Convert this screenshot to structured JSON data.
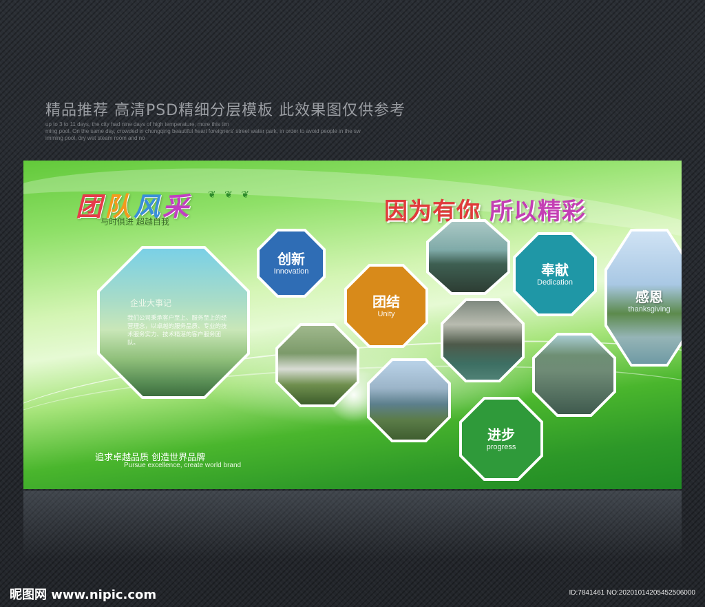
{
  "header": {
    "title": "精品推荐 高清PSD精细分层模板 此效果图仅供参考",
    "sub_lines": [
      "up to 3 to 11 days, the city had nine days of high temperature, more this tim",
      "ming pool. On the same day, crowded in chongqing beautiful heart foreigners' street water park, in order to avoid people in the sw",
      "imming pool, dry wet steam room and no"
    ]
  },
  "board": {
    "team_title_chars": [
      "团",
      "队",
      "风",
      "采"
    ],
    "team_subtitle": "与时俱进 超越自我",
    "slogan_part1": "因为有你",
    "slogan_part2": "所以精彩",
    "event_box": {
      "title": "企业大事记",
      "body": "我们公司秉承客户至上、服务至上的经营理念，以卓越的服务品质、专业的技术服务实力、技术精湛的客户服务团队。"
    },
    "values": [
      {
        "cn": "创新",
        "en": "Innovation",
        "color": "#2f6db5"
      },
      {
        "cn": "团结",
        "en": "Unity",
        "color": "#d88a1a"
      },
      {
        "cn": "奉献",
        "en": "Dedication",
        "color": "#1f97a6"
      },
      {
        "cn": "进步",
        "en": "progress",
        "color": "#2f9a3a"
      },
      {
        "cn": "感恩",
        "en": "thanksgiving",
        "color": ""
      }
    ],
    "bottom_cn": "追求卓越品质 创造世界品牌",
    "bottom_en": "Pursue excellence, create world brand"
  },
  "footer": {
    "watermark": "昵图网 www.nipic.com",
    "photo_id": "ID:7841461 NO:20201014205452506000"
  }
}
